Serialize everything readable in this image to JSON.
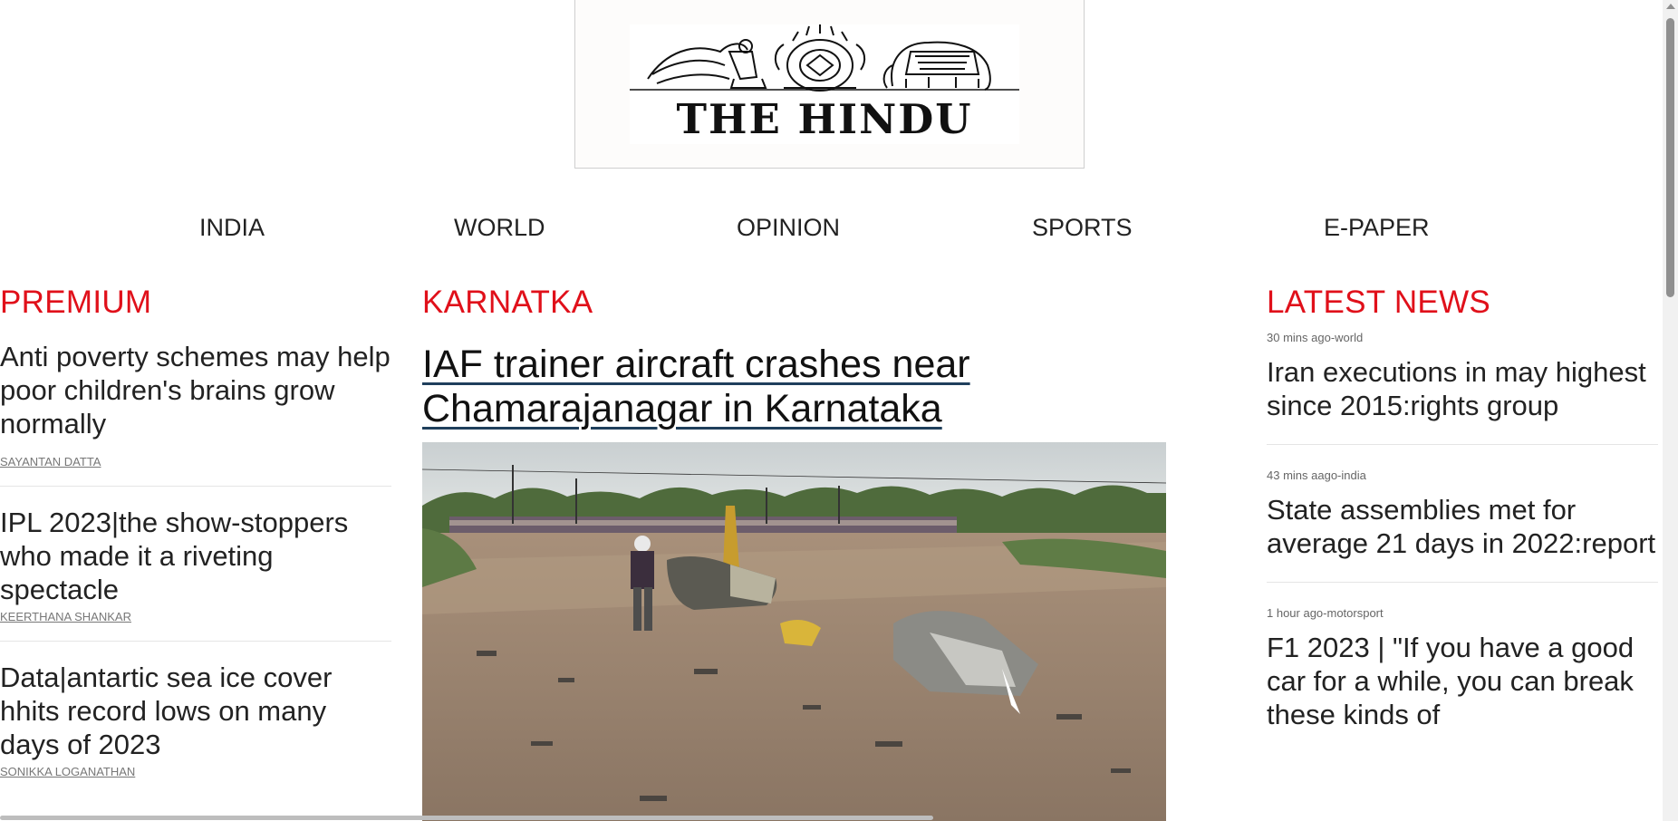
{
  "masthead": {
    "logo_text": "THE HINDU"
  },
  "nav": {
    "items": [
      {
        "label": "INDIA"
      },
      {
        "label": "WORLD"
      },
      {
        "label": "OPINION"
      },
      {
        "label": "SPORTS"
      },
      {
        "label": "E-PAPER"
      }
    ]
  },
  "premium": {
    "heading": "PREMIUM",
    "stories": [
      {
        "title": "Anti poverty schemes may help poor children's brains grow normally",
        "author": "SAYANTAN DATTA"
      },
      {
        "title": "IPL 2023|the show-stoppers who made it a riveting spectacle",
        "author": "KEERTHANA SHANKAR"
      },
      {
        "title": "Data|antartic sea ice cover hhits record lows on many days of 2023",
        "author": "SONIKKA LOGANATHAN"
      }
    ]
  },
  "lead": {
    "section": "KARNATKA",
    "title": "IAF trainer aircraft crashes near Chamarajanagar in Karnataka"
  },
  "latest": {
    "heading": "LATEST NEWS",
    "items": [
      {
        "meta": "30 mins ago-world",
        "title": "Iran executions in may highest since 2015:rights group"
      },
      {
        "meta": "43 mins aago-india",
        "title": "State assemblies met for average 21 days in 2022:report"
      },
      {
        "meta": "1 hour ago-motorsport",
        "title": "F1 2023 | \"If you have a good car for a while, you can break these kinds of"
      }
    ]
  },
  "colors": {
    "section_heading": "#e0101a",
    "text": "#222222",
    "lead_underline": "#1f3f5c"
  }
}
